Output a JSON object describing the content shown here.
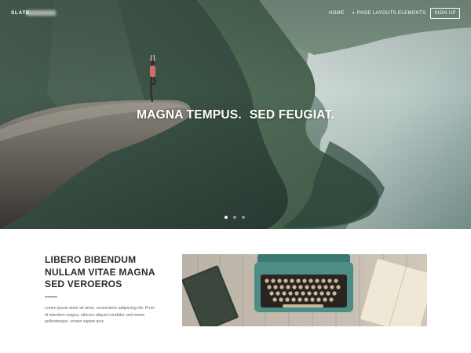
{
  "header": {
    "brand": "SLATE",
    "nav": [
      {
        "label": "HOME"
      },
      {
        "label": "PAGE LAYOUTS"
      },
      {
        "label": "ELEMENTS"
      }
    ],
    "signup_label": "SIGN UP"
  },
  "hero": {
    "headline_part1": "MAGNA TEMPUS.",
    "headline_part2": "SED FEUGIAT.",
    "slides": {
      "count": 3,
      "active": 1
    }
  },
  "feature": {
    "title_lines": [
      "LIBERO BIBENDUM",
      "NULLAM VITAE MAGNA",
      "SED VEROEROS"
    ],
    "body_lines": [
      "Lorem ipsum dolor sit amet, consectetur adipiscing elit. Proin",
      "id interdum magna, ultricies aliquet curabitur sed metus",
      "pellentesque, ornare sapien quis."
    ]
  },
  "colors": {
    "white": "#ffffff",
    "heading": "#2b2b2b",
    "body": "#666666",
    "lake": "#b7c9c6",
    "typewriter": "#4e8c86"
  }
}
